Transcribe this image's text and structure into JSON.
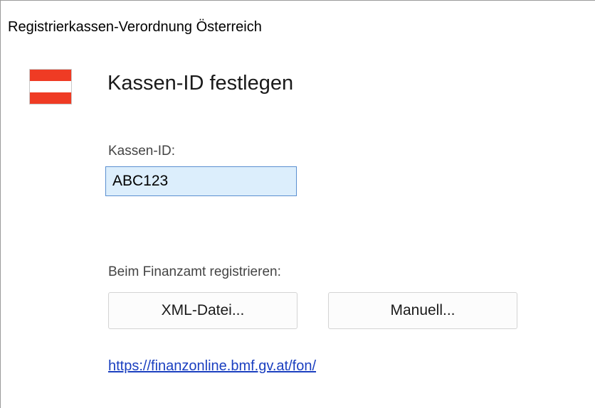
{
  "window": {
    "title": "Registrierkassen-Verordnung Österreich"
  },
  "header": {
    "icon": "austria-flag-icon",
    "heading": "Kassen-ID festlegen"
  },
  "kassen_id": {
    "label": "Kassen-ID:",
    "value": "ABC123"
  },
  "registration": {
    "label": "Beim Finanzamt registrieren:",
    "xml_button": "XML-Datei...",
    "manual_button": "Manuell..."
  },
  "link": {
    "text": "https://finanzonline.bmf.gv.at/fon/"
  },
  "colors": {
    "flag_red": "#ef3b24",
    "input_background": "#dceefc",
    "link": "#1a3fc0"
  }
}
